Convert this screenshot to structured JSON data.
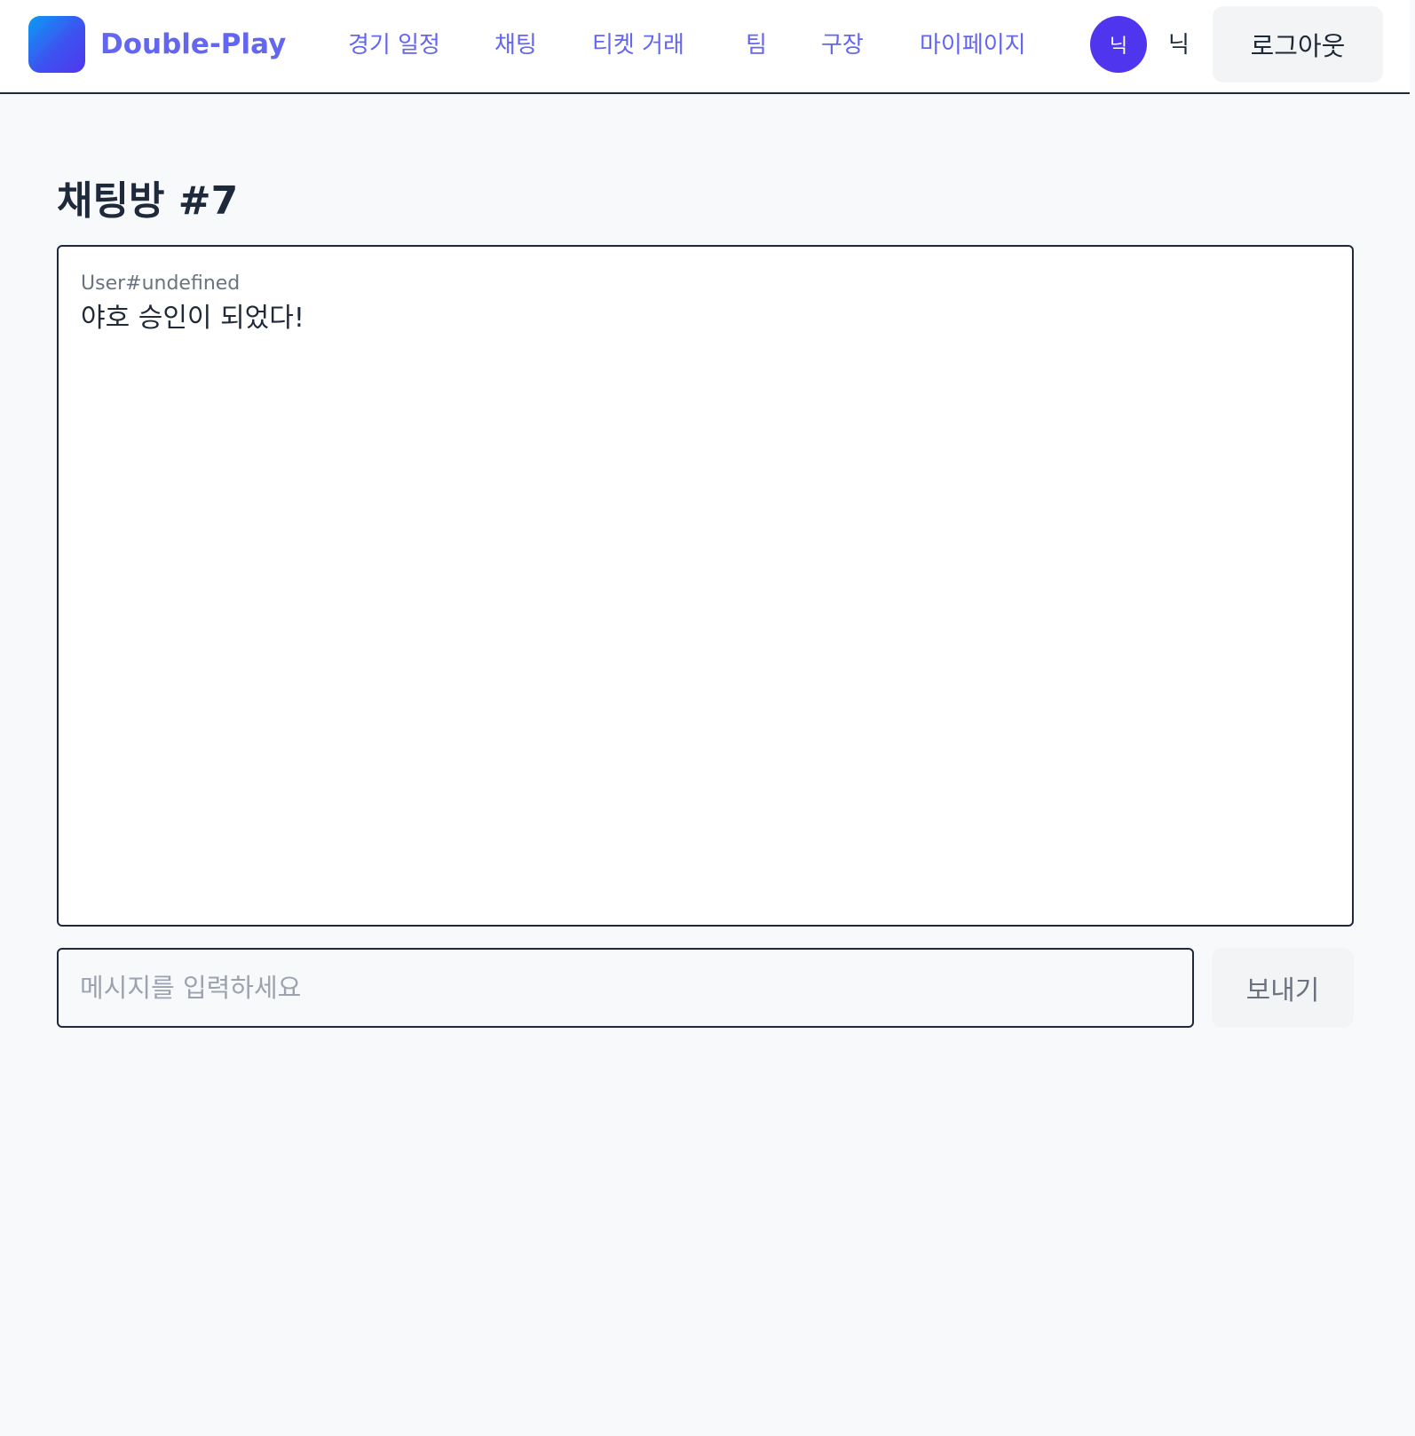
{
  "header": {
    "brand_name": "Double-Play",
    "nav": [
      {
        "label": "경기 일정"
      },
      {
        "label": "채팅"
      },
      {
        "label": "티켓 거래"
      },
      {
        "label": "팀"
      },
      {
        "label": "구장"
      },
      {
        "label": "마이페이지"
      }
    ],
    "user": {
      "avatar_initial": "닉",
      "name": "닉"
    },
    "logout_label": "로그아웃"
  },
  "main": {
    "title": "채팅방 #7",
    "messages": [
      {
        "sender": "User#undefined",
        "text": "야호 승인이 되었다!"
      }
    ],
    "composer": {
      "placeholder": "메시지를 입력하세요",
      "value": "",
      "send_label": "보내기"
    }
  },
  "colors": {
    "accent": "#6366f1",
    "avatar": "#4f35ee",
    "border": "#1e293b",
    "background": "#f8f9fb"
  }
}
